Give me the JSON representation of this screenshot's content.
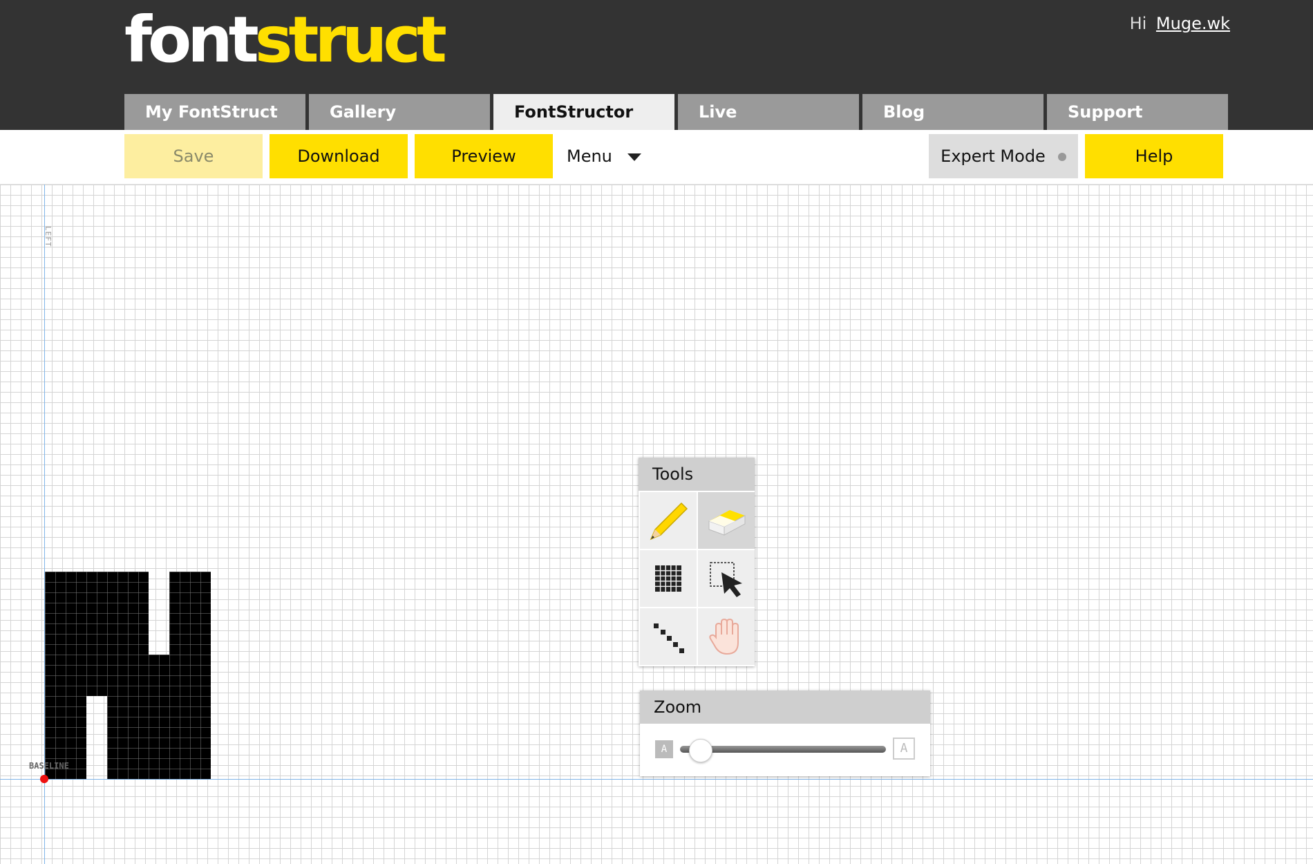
{
  "header": {
    "logo_part1": "font",
    "logo_part2": "struct",
    "greeting": "Hi",
    "username": "Muge.wk"
  },
  "nav": {
    "tabs": [
      {
        "label": "My FontStruct"
      },
      {
        "label": "Gallery"
      },
      {
        "label": "FontStructor",
        "active": true
      },
      {
        "label": "Live"
      },
      {
        "label": "Blog"
      },
      {
        "label": "Support"
      }
    ]
  },
  "toolbar": {
    "save_label": "Save",
    "download_label": "Download",
    "preview_label": "Preview",
    "menu_label": "Menu",
    "expert_label": "Expert Mode",
    "help_label": "Help"
  },
  "canvas": {
    "left_label": "LEFT",
    "baseline_label": "BASELINE"
  },
  "tools_panel": {
    "title": "Tools",
    "tools": [
      "pencil-icon",
      "eraser-icon",
      "grid-fill-icon",
      "select-icon",
      "line-icon",
      "hand-icon"
    ],
    "selected": "eraser-icon"
  },
  "zoom_panel": {
    "title": "Zoom",
    "small_glyph": "A",
    "large_glyph": "A",
    "level": 0.07
  },
  "colors": {
    "accent": "#ffdf00",
    "header_bg": "#333333",
    "guide": "#7fb4e8",
    "origin": "#ee1111"
  }
}
